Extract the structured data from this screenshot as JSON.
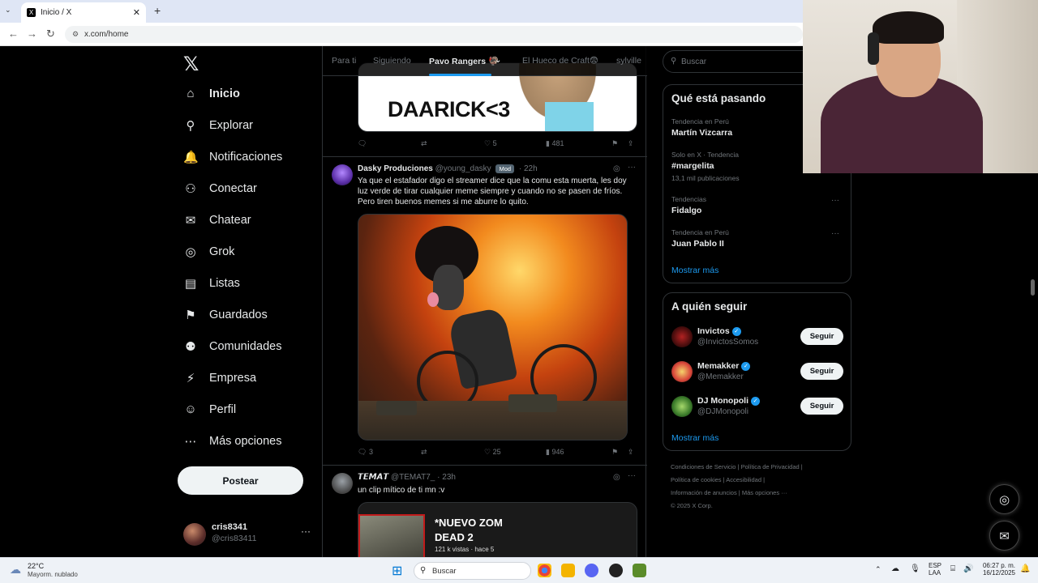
{
  "browser": {
    "tab_title": "Inicio / X",
    "tab_close": "✕",
    "new_tab": "+",
    "url": "x.com/home"
  },
  "sidebar": {
    "logo": "𝕏",
    "items": [
      {
        "icon": "home-icon",
        "glyph": "⌂",
        "label": "Inicio"
      },
      {
        "icon": "explore-icon",
        "glyph": "⚲",
        "label": "Explorar"
      },
      {
        "icon": "bell-icon",
        "glyph": "🔔",
        "label": "Notificaciones"
      },
      {
        "icon": "add-person-icon",
        "glyph": "⚇",
        "label": "Conectar"
      },
      {
        "icon": "mail-icon",
        "glyph": "✉",
        "label": "Chatear"
      },
      {
        "icon": "grok-icon",
        "glyph": "◎",
        "label": "Grok"
      },
      {
        "icon": "list-icon",
        "glyph": "▤",
        "label": "Listas"
      },
      {
        "icon": "bookmark-icon",
        "glyph": "⚑",
        "label": "Guardados"
      },
      {
        "icon": "communities-icon",
        "glyph": "⚉",
        "label": "Comunidades"
      },
      {
        "icon": "lightning-icon",
        "glyph": "⚡",
        "label": "Empresa"
      },
      {
        "icon": "person-icon",
        "glyph": "☺",
        "label": "Perfil"
      },
      {
        "icon": "more-circle-icon",
        "glyph": "⋯",
        "label": "Más opciones"
      }
    ],
    "post_button": "Postear",
    "account": {
      "name": "cris8341",
      "handle": "@cris83411",
      "menu": "···"
    }
  },
  "feed": {
    "tabs": [
      "Para ti",
      "Siguiendo",
      "Pavo Rangers 🦃",
      "El Hueco de Craft😨",
      "sylville"
    ],
    "top_tweet": {
      "image_text": "DAARICK<3",
      "replies": "",
      "retweets": "",
      "likes": "5",
      "views": "481"
    },
    "tweet1": {
      "name": "Dasky Produciones",
      "handle": "@young_dasky",
      "badge": "Mod",
      "time": "· 22h",
      "text": "Ya que el estafador digo el streamer dice que la comu esta muerta, les doy luz verde de tirar cualquier meme siempre y cuando no se pasen de fríos. Pero tiren buenos memes si me aburre lo quito.",
      "replies": "3",
      "likes": "25",
      "views": "946"
    },
    "tweet2": {
      "name": "𝙏𝙀𝙈𝘼𝙏",
      "handle": "@TEMAT7_",
      "time": "· 23h",
      "text": "un clip mítico de ti mn :v",
      "card_title_1": "*NUEVO ZOM",
      "card_title_2": "DEAD 2",
      "card_meta": "121 k vistas · hace 5"
    }
  },
  "right": {
    "search_placeholder": "Buscar",
    "trends_title": "Qué está pasando",
    "trends": [
      {
        "meta": "Tendencia en Perú",
        "name": "Martín Vizcarra",
        "count": ""
      },
      {
        "meta": "Solo en X · Tendencia",
        "name": "#margelita",
        "count": "13,1 mil publicaciones"
      },
      {
        "meta": "Tendencias",
        "name": "Fidalgo",
        "count": ""
      },
      {
        "meta": "Tendencia en Perú",
        "name": "Juan Pablo II",
        "count": ""
      }
    ],
    "show_more": "Mostrar más",
    "follow_title": "A quién seguir",
    "follow": [
      {
        "name": "Invictos",
        "handle": "@InvictosSomos",
        "button": "Seguir"
      },
      {
        "name": "Memakker",
        "handle": "@Memakker",
        "button": "Seguir"
      },
      {
        "name": "DJ Monopoli",
        "handle": "@DJMonopoli",
        "button": "Seguir"
      }
    ],
    "show_more_2": "Mostrar más",
    "footer_lines": [
      "Condiciones de Servicio  |  Política de Privacidad  |",
      "Política de cookies  |  Accesibilidad  |",
      "Información de anuncios  |  Más opciones ···",
      "© 2025 X Corp."
    ]
  },
  "taskbar": {
    "weather_temp": "22°C",
    "weather_desc": "Mayorm. nublado",
    "search": "Buscar",
    "lang_1": "ESP",
    "lang_2": "LAA",
    "time": "06:27 p. m.",
    "date": "16/12/2025"
  },
  "colors": {
    "accent": "#1d9bf0",
    "bg": "#000000",
    "text": "#e7e9ea",
    "muted": "#71767b"
  }
}
